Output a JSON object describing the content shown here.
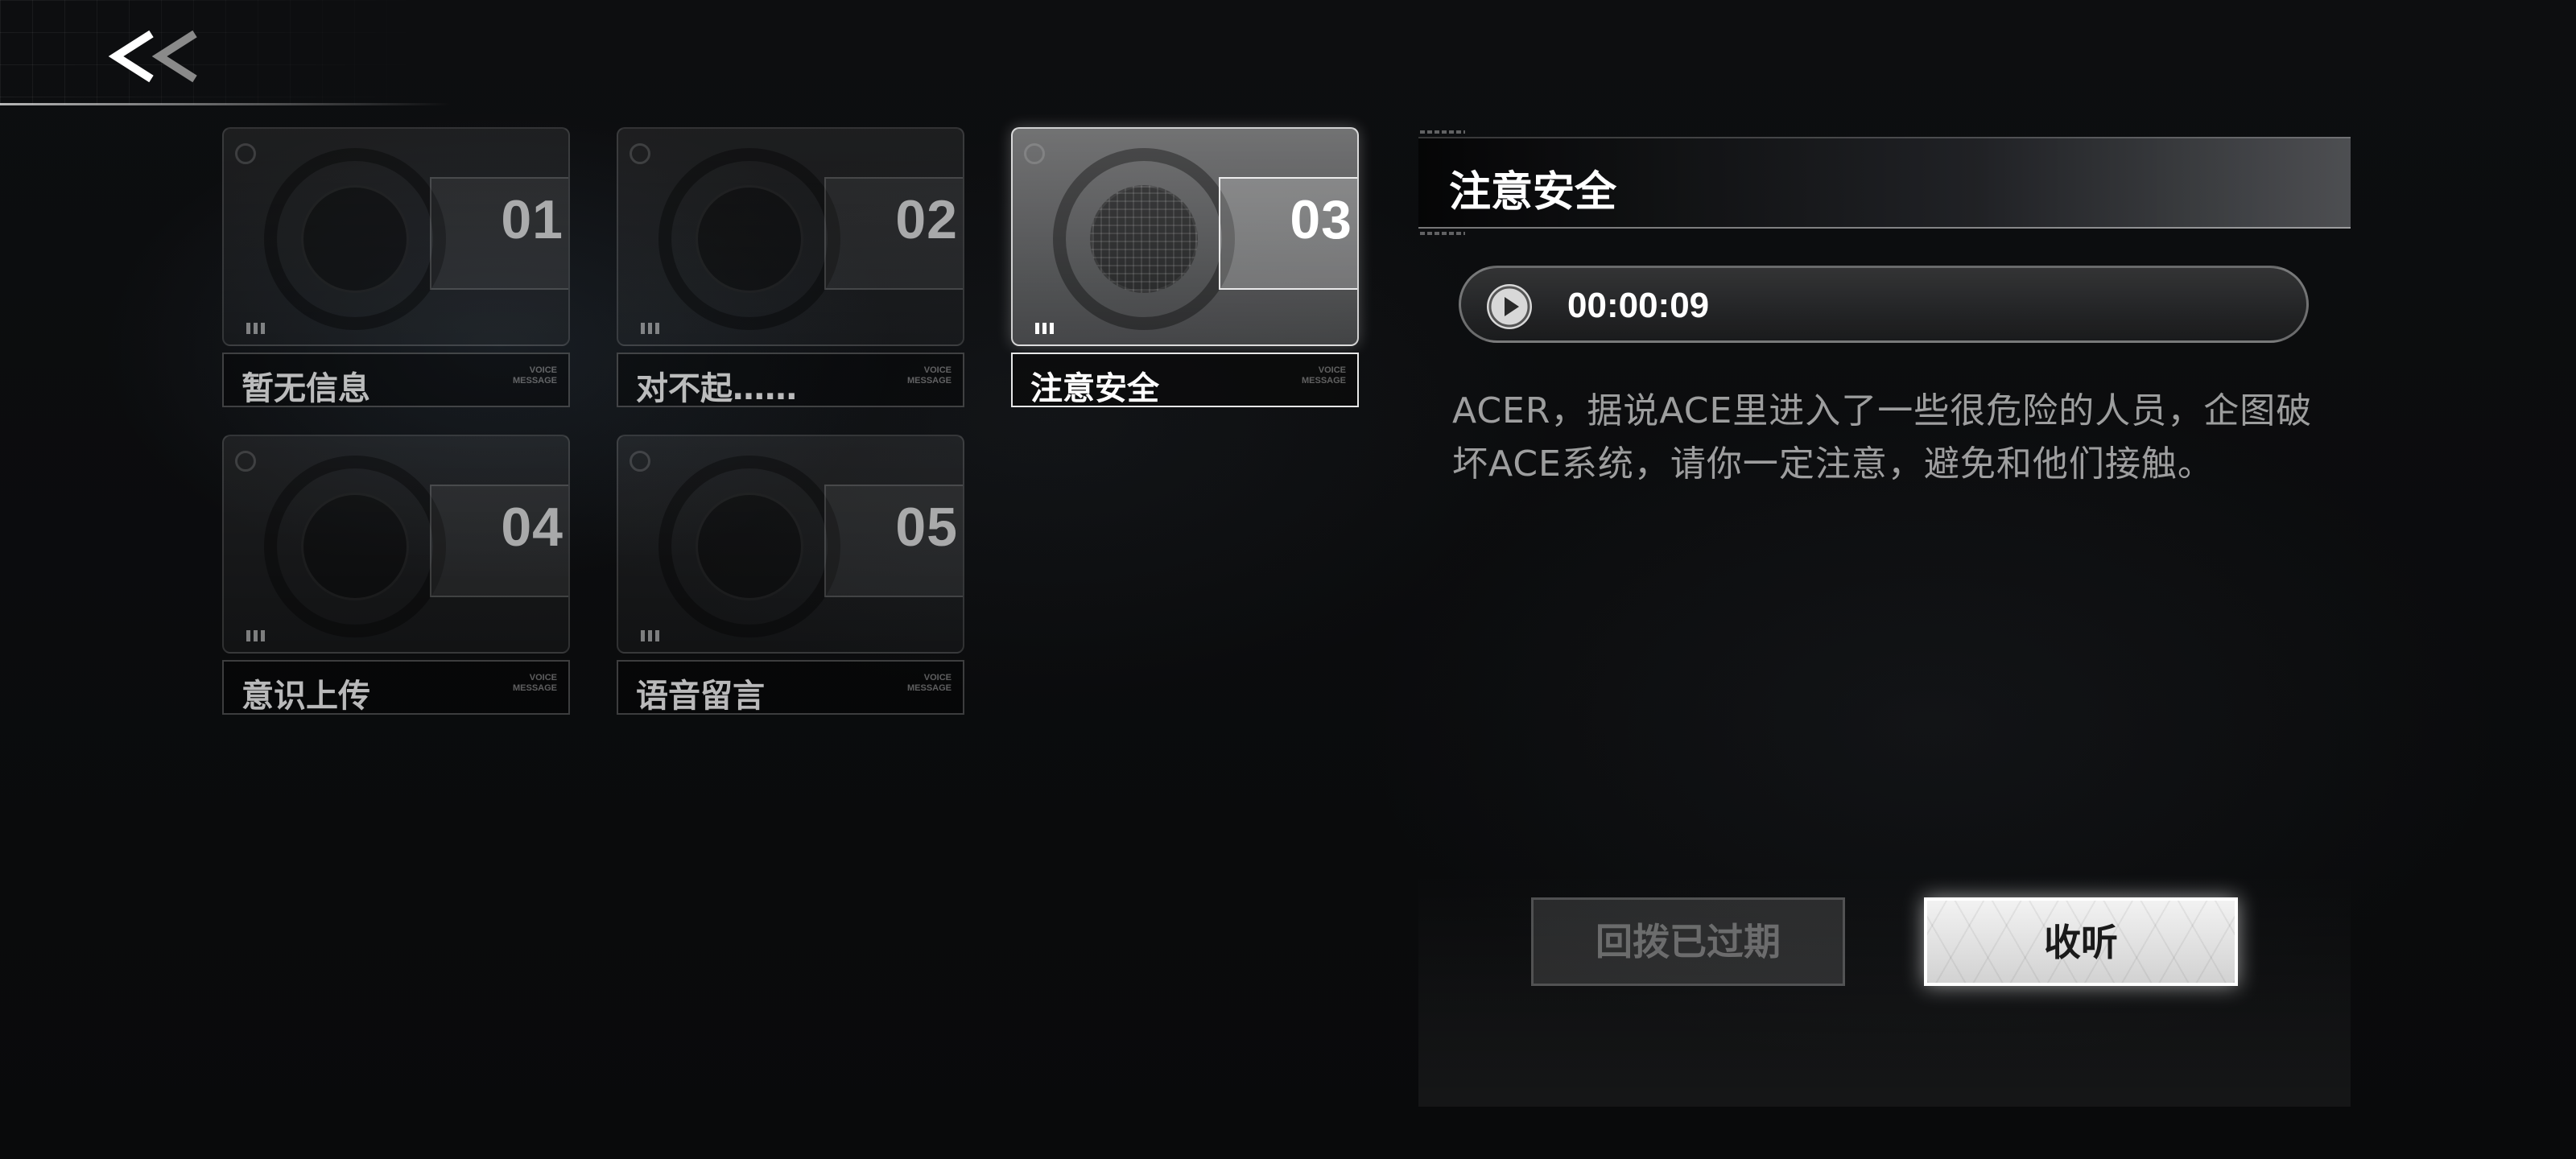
{
  "colors": {
    "background": "#0b0c0e",
    "accent": "#ffffff",
    "text_muted": "#9a9a9a"
  },
  "header": {
    "back_icon": "double-chevron-left-icon"
  },
  "messages": [
    {
      "number": "01",
      "title": "暂无信息",
      "tag_line1": "VOICE",
      "tag_line2": "MESSAGE",
      "selected": false
    },
    {
      "number": "02",
      "title": "对不起……",
      "tag_line1": "VOICE",
      "tag_line2": "MESSAGE",
      "selected": false
    },
    {
      "number": "03",
      "title": "注意安全",
      "tag_line1": "VOICE",
      "tag_line2": "MESSAGE",
      "selected": true
    },
    {
      "number": "04",
      "title": "意识上传",
      "tag_line1": "VOICE",
      "tag_line2": "MESSAGE",
      "selected": false
    },
    {
      "number": "05",
      "title": "语音留言",
      "tag_line1": "VOICE",
      "tag_line2": "MESSAGE",
      "selected": false
    }
  ],
  "detail": {
    "title": "注意安全",
    "audio": {
      "play_icon": "play-icon",
      "duration": "00:00:09"
    },
    "body": "ACER，据说ACE里进入了一些很危险的人员，企图破坏ACE系统，请你一定注意，避免和他们接触。",
    "callback_button": "回拨已过期",
    "listen_button": "收听"
  }
}
